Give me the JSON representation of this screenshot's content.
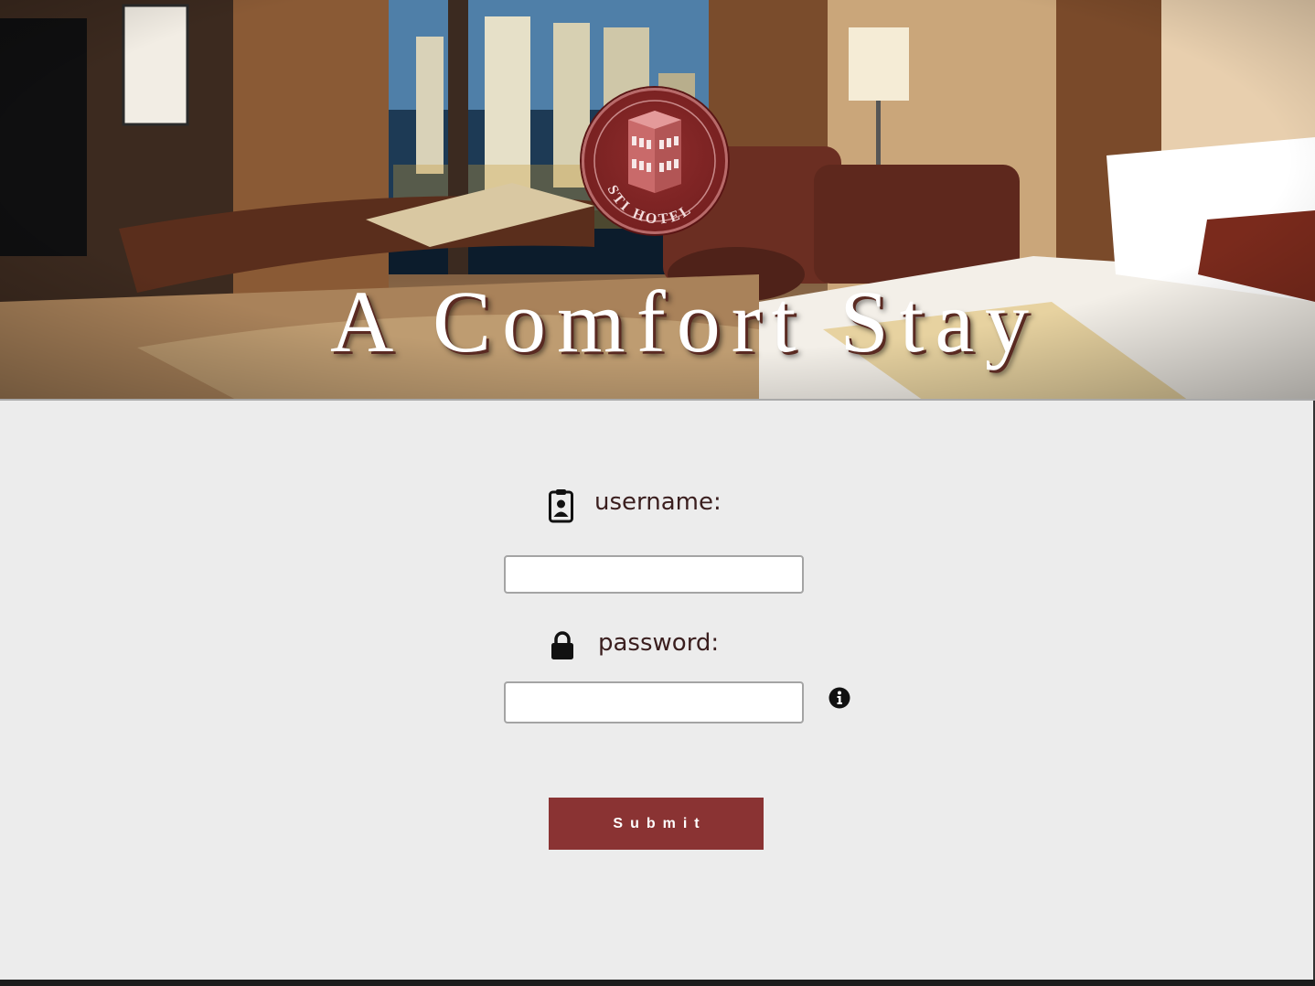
{
  "hero": {
    "title": "A Comfort Stay",
    "logo": {
      "text": "STI HOTEL",
      "icon": "hotel-building-icon",
      "color": "#7a2020"
    }
  },
  "form": {
    "username": {
      "label": "username:",
      "icon": "id-badge-icon",
      "value": "",
      "placeholder": ""
    },
    "password": {
      "label": "password:",
      "icon": "lock-icon",
      "info_icon": "info-circle-icon",
      "value": "",
      "placeholder": ""
    },
    "submit_label": "Submit"
  },
  "colors": {
    "background": "#ececec",
    "accent": "#8a3333",
    "label_text": "#3a1e1e"
  }
}
